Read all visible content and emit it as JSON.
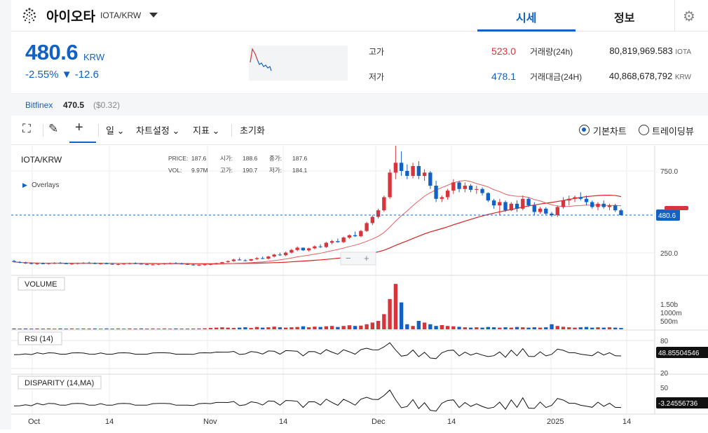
{
  "header": {
    "coin_name": "아이오타",
    "pair": "IOTA/KRW",
    "tabs": [
      "시세",
      "정보"
    ],
    "active_tab": "시세"
  },
  "price": {
    "value": "480.6",
    "unit": "KRW",
    "change_pct": "-2.55%",
    "change_abs": "▼ -12.6",
    "high_label": "고가",
    "high_value": "523.0",
    "low_label": "저가",
    "low_value": "478.1",
    "volume_label": "거래량(24h)",
    "volume_value": "80,819,969.583",
    "volume_unit": "IOTA",
    "amount_label": "거래대금(24H)",
    "amount_value": "40,868,678,792",
    "amount_unit": "KRW"
  },
  "exchange": {
    "name": "Bitfinex",
    "price": "470.5",
    "usd": "($0.32)"
  },
  "toolbar": {
    "period": "일",
    "chart_settings": "차트설정",
    "indicators": "지표",
    "reset": "초기화",
    "mode_basic": "기본차트",
    "mode_tradingview": "트레이딩뷰"
  },
  "colors": {
    "up": "#d8343c",
    "down": "#1261c4",
    "accent": "#1261c4"
  },
  "legend": {
    "pair": "IOTA/KRW",
    "overlays": "Overlays",
    "price_lbl": "PRICE:",
    "price_val": "187.6",
    "open_lbl": "시가:",
    "open_val": "188.6",
    "close_lbl": "종가:",
    "close_val": "187.6",
    "vol_lbl": "VOL:",
    "vol_val": "9.97M",
    "high_lbl": "고가:",
    "high_val": "190.7",
    "low_lbl": "저가:",
    "low_val": "184.1"
  },
  "chart_data": [
    {
      "type": "candlestick",
      "title": "IOTA/KRW",
      "x_ticks": [
        "Oct",
        "14",
        "Nov",
        "14",
        "Dec",
        "14",
        "2025",
        "14"
      ],
      "y_ticks": [
        250.0,
        750.0
      ],
      "last_price_label": "480.6",
      "ohlc": [
        [
          201,
          207,
          192,
          195
        ],
        [
          195,
          200,
          187,
          190
        ],
        [
          190,
          196,
          184,
          188
        ],
        [
          188,
          193,
          180,
          183
        ],
        [
          183,
          190,
          178,
          186
        ],
        [
          186,
          192,
          181,
          184
        ],
        [
          184,
          190,
          179,
          187
        ],
        [
          187,
          194,
          182,
          189
        ],
        [
          189,
          195,
          184,
          186
        ],
        [
          186,
          191,
          181,
          183
        ],
        [
          183,
          189,
          178,
          185
        ],
        [
          185,
          191,
          180,
          188
        ],
        [
          188,
          194,
          183,
          190
        ],
        [
          190,
          196,
          185,
          187
        ],
        [
          187,
          192,
          182,
          184
        ],
        [
          184,
          190,
          179,
          186
        ],
        [
          186,
          192,
          181,
          183
        ],
        [
          183,
          188,
          178,
          180
        ],
        [
          180,
          186,
          175,
          182
        ],
        [
          182,
          188,
          177,
          185
        ],
        [
          185,
          191,
          180,
          187
        ],
        [
          187,
          193,
          182,
          184
        ],
        [
          184,
          189,
          179,
          181
        ],
        [
          181,
          187,
          176,
          178
        ],
        [
          178,
          184,
          173,
          180
        ],
        [
          180,
          186,
          175,
          183
        ],
        [
          183,
          189,
          178,
          186
        ],
        [
          186,
          192,
          181,
          188
        ],
        [
          188,
          194,
          183,
          185
        ],
        [
          185,
          190,
          180,
          182
        ],
        [
          182,
          188,
          177,
          179
        ],
        [
          179,
          184,
          173,
          175
        ],
        [
          175,
          181,
          170,
          177
        ],
        [
          177,
          183,
          172,
          180
        ],
        [
          180,
          186,
          175,
          182
        ],
        [
          182,
          190,
          178,
          188
        ],
        [
          188,
          196,
          184,
          194
        ],
        [
          194,
          205,
          190,
          200
        ],
        [
          200,
          215,
          196,
          210
        ],
        [
          210,
          222,
          204,
          205
        ],
        [
          205,
          212,
          198,
          203
        ],
        [
          203,
          214,
          200,
          212
        ],
        [
          212,
          224,
          208,
          218
        ],
        [
          218,
          228,
          212,
          215
        ],
        [
          215,
          232,
          210,
          228
        ],
        [
          228,
          245,
          222,
          240
        ],
        [
          240,
          252,
          232,
          236
        ],
        [
          236,
          258,
          230,
          252
        ],
        [
          252,
          275,
          246,
          268
        ],
        [
          268,
          290,
          260,
          282
        ],
        [
          282,
          276,
          262,
          266
        ],
        [
          266,
          282,
          258,
          278
        ],
        [
          278,
          296,
          272,
          290
        ],
        [
          290,
          302,
          280,
          286
        ],
        [
          286,
          318,
          280,
          312
        ],
        [
          312,
          330,
          302,
          322
        ],
        [
          322,
          338,
          312,
          316
        ],
        [
          316,
          350,
          310,
          344
        ],
        [
          344,
          362,
          336,
          358
        ],
        [
          358,
          380,
          348,
          352
        ],
        [
          352,
          390,
          346,
          384
        ],
        [
          384,
          440,
          378,
          432
        ],
        [
          432,
          480,
          420,
          470
        ],
        [
          470,
          520,
          460,
          510
        ],
        [
          510,
          600,
          500,
          590
        ],
        [
          590,
          760,
          580,
          740
        ],
        [
          740,
          950,
          700,
          800
        ],
        [
          800,
          870,
          720,
          750
        ],
        [
          750,
          790,
          700,
          720
        ],
        [
          720,
          800,
          705,
          780
        ],
        [
          780,
          810,
          700,
          720
        ],
        [
          720,
          760,
          690,
          740
        ],
        [
          740,
          750,
          640,
          660
        ],
        [
          660,
          690,
          560,
          580
        ],
        [
          580,
          600,
          560,
          590
        ],
        [
          590,
          640,
          575,
          630
        ],
        [
          630,
          700,
          610,
          680
        ],
        [
          680,
          690,
          620,
          640
        ],
        [
          640,
          680,
          620,
          660
        ],
        [
          660,
          670,
          620,
          635
        ],
        [
          635,
          660,
          610,
          640
        ],
        [
          640,
          650,
          600,
          615
        ],
        [
          615,
          620,
          560,
          570
        ],
        [
          570,
          580,
          520,
          540
        ],
        [
          540,
          580,
          480,
          560
        ],
        [
          560,
          570,
          500,
          510
        ],
        [
          510,
          560,
          505,
          550
        ],
        [
          550,
          570,
          500,
          520
        ],
        [
          520,
          600,
          510,
          580
        ],
        [
          580,
          590,
          530,
          540
        ],
        [
          540,
          560,
          480,
          500
        ],
        [
          500,
          530,
          490,
          520
        ],
        [
          520,
          530,
          480,
          490
        ],
        [
          490,
          500,
          470,
          480
        ],
        [
          480,
          540,
          470,
          530
        ],
        [
          530,
          590,
          520,
          570
        ],
        [
          570,
          600,
          540,
          580
        ],
        [
          580,
          600,
          560,
          590
        ],
        [
          590,
          620,
          570,
          580
        ],
        [
          580,
          600,
          540,
          560
        ],
        [
          560,
          570,
          520,
          530
        ],
        [
          530,
          560,
          510,
          550
        ],
        [
          550,
          570,
          520,
          530
        ],
        [
          530,
          550,
          510,
          540
        ],
        [
          540,
          550,
          500,
          510
        ],
        [
          510,
          520,
          478,
          480.6
        ]
      ],
      "volume": [
        0.05,
        0.04,
        0.05,
        0.04,
        0.05,
        0.04,
        0.05,
        0.04,
        0.05,
        0.04,
        0.05,
        0.04,
        0.05,
        0.04,
        0.05,
        0.04,
        0.05,
        0.04,
        0.05,
        0.04,
        0.05,
        0.04,
        0.05,
        0.04,
        0.05,
        0.04,
        0.05,
        0.04,
        0.05,
        0.04,
        0.04,
        0.04,
        0.05,
        0.06,
        0.08,
        0.1,
        0.12,
        0.1,
        0.08,
        0.1,
        0.12,
        0.08,
        0.14,
        0.1,
        0.12,
        0.16,
        0.12,
        0.1,
        0.12,
        0.14,
        0.18,
        0.12,
        0.16,
        0.14,
        0.18,
        0.2,
        0.14,
        0.2,
        0.24,
        0.2,
        0.22,
        0.3,
        0.4,
        0.5,
        0.9,
        1.8,
        2.7,
        1.6,
        0.3,
        0.2,
        0.5,
        0.4,
        0.3,
        0.2,
        0.25,
        0.2,
        0.18,
        0.15,
        0.12,
        0.1,
        0.12,
        0.1,
        0.14,
        0.12,
        0.1,
        0.12,
        0.1,
        0.14,
        0.12,
        0.1,
        0.12,
        0.1,
        0.12,
        0.3,
        0.2,
        0.15,
        0.12,
        0.1,
        0.12,
        0.14,
        0.1,
        0.12,
        0.1,
        0.12,
        0.1,
        0.08
      ],
      "volume_y_ticks": [
        "1.50b",
        "1000m",
        "500m"
      ],
      "ma_short": [],
      "ma_long": []
    },
    {
      "type": "line",
      "title": "RSI (14)",
      "y_ticks": [
        80,
        20
      ],
      "last_label": "48.85504546"
    },
    {
      "type": "line",
      "title": "DISPARITY (14,MA)",
      "y_ticks": [
        50
      ],
      "last_label": "-3.24556736"
    }
  ]
}
